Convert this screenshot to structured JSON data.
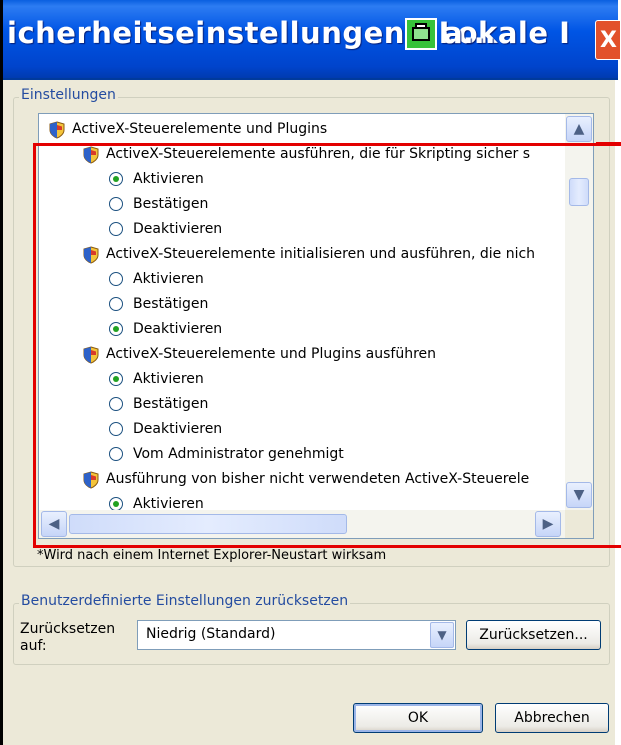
{
  "window": {
    "title": "icherheitseinstellungen - Lokale I",
    "title_trail": "a...",
    "close_glyph": "X"
  },
  "settings": {
    "group_label": "Einstellungen",
    "items": [
      {
        "kind": "category",
        "label": "ActiveX-Steuerelemente und Plugins"
      },
      {
        "kind": "setting",
        "label": "ActiveX-Steuerelemente ausführen, die für Skripting sicher s"
      },
      {
        "kind": "option",
        "label": "Aktivieren",
        "selected": true
      },
      {
        "kind": "option",
        "label": "Bestätigen",
        "selected": false
      },
      {
        "kind": "option",
        "label": "Deaktivieren",
        "selected": false
      },
      {
        "kind": "setting",
        "label": "ActiveX-Steuerelemente initialisieren und ausführen, die nich"
      },
      {
        "kind": "option",
        "label": "Aktivieren",
        "selected": false
      },
      {
        "kind": "option",
        "label": "Bestätigen",
        "selected": false
      },
      {
        "kind": "option",
        "label": "Deaktivieren",
        "selected": true
      },
      {
        "kind": "setting",
        "label": "ActiveX-Steuerelemente und Plugins ausführen"
      },
      {
        "kind": "option",
        "label": "Aktivieren",
        "selected": true
      },
      {
        "kind": "option",
        "label": "Bestätigen",
        "selected": false
      },
      {
        "kind": "option",
        "label": "Deaktivieren",
        "selected": false
      },
      {
        "kind": "option",
        "label": "Vom Administrator genehmigt",
        "selected": false
      },
      {
        "kind": "setting",
        "label": "Ausführung von bisher nicht verwendeten ActiveX-Steuerele"
      },
      {
        "kind": "option",
        "label": "Aktivieren",
        "selected": true
      }
    ],
    "note": "*Wird nach einem Internet Explorer-Neustart wirksam"
  },
  "reset": {
    "group_label": "Benutzerdefinierte Einstellungen zurücksetzen",
    "label_line1": "Zurücksetzen",
    "label_line2": "auf:",
    "selected_value": "Niedrig (Standard)",
    "reset_button": "Zurücksetzen..."
  },
  "footer": {
    "ok_button": "OK",
    "cancel_button": "Abbrechen"
  },
  "colors": {
    "titlebar": "#0055e5",
    "highlight_box": "#e30000",
    "group_label": "#244ca0"
  }
}
